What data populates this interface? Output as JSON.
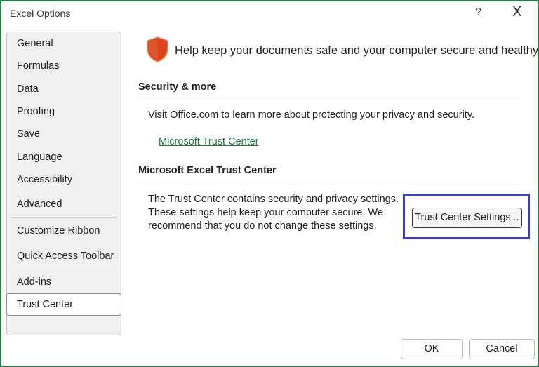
{
  "window": {
    "title": "Excel Options",
    "help_label": "?",
    "close_label": "X"
  },
  "sidebar": {
    "items": [
      {
        "label": "General"
      },
      {
        "label": "Formulas"
      },
      {
        "label": "Data"
      },
      {
        "label": "Proofing"
      },
      {
        "label": "Save"
      },
      {
        "label": "Language"
      },
      {
        "label": "Accessibility"
      },
      {
        "label": "Advanced"
      },
      {
        "label": "Customize Ribbon"
      },
      {
        "label": "Quick Access Toolbar"
      },
      {
        "label": "Add-ins"
      },
      {
        "label": "Trust Center"
      }
    ],
    "selected": "Trust Center"
  },
  "main": {
    "header": "Help keep your documents safe and your computer secure and healthy.",
    "security_heading": "Security & more",
    "security_text": "Visit Office.com to learn more about protecting your privacy and security.",
    "trust_link": "Microsoft Trust Center",
    "trust_heading": "Microsoft Excel Trust Center",
    "trust_text": [
      "The Trust Center contains security and privacy settings.",
      "These settings help keep your computer secure. We",
      "recommend that you do not change these settings."
    ],
    "trust_button": "Trust Center Settings..."
  },
  "footer": {
    "ok": "OK",
    "cancel": "Cancel"
  },
  "colors": {
    "frame": "#2a7a4b",
    "highlight": "#3a43b6",
    "shield": "#d9441c",
    "link": "#1e7a3e"
  }
}
